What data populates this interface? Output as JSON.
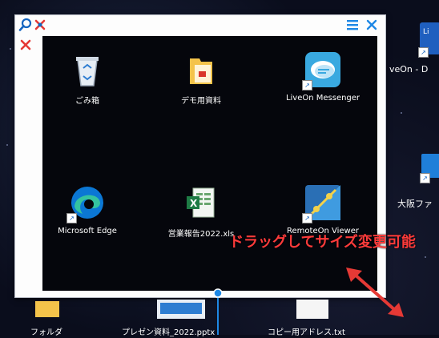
{
  "desktop": {
    "background_color": "#0a0d1c",
    "right_icons": [
      {
        "label": "veOn - D",
        "icon": "liveon-desktop-icon"
      },
      {
        "label": "大阪ファ",
        "icon": "folder-icon"
      }
    ],
    "bottom_icons": [
      {
        "label": "フォルダ",
        "icon": "folder-icon"
      },
      {
        "label": "プレゼン資料_2022.pptx",
        "icon": "powerpoint-file-icon"
      },
      {
        "label": "コピー用アドレス.txt",
        "icon": "text-file-icon"
      }
    ]
  },
  "viewer": {
    "toolbar": {
      "zoom_icon": "magnifier-icon",
      "pin_icon": "pin-icon",
      "menu_icon": "hamburger-menu-icon",
      "close_icon": "close-icon",
      "side_pin_icon": "pin-icon"
    },
    "icons": [
      {
        "label": "ごみ箱",
        "icon": "recycle-bin-icon"
      },
      {
        "label": "デモ用資料",
        "icon": "folder-icon"
      },
      {
        "label": "LiveOn Messenger",
        "icon": "liveon-messenger-icon"
      },
      {
        "label": "Microsoft Edge",
        "icon": "edge-browser-icon"
      },
      {
        "label": "営業報告2022.xls",
        "icon": "excel-file-icon"
      },
      {
        "label": "RemoteOn Viewer",
        "icon": "remoteon-viewer-icon"
      }
    ]
  },
  "annotation": {
    "caption": "ドラッグしてサイズ変更可能",
    "caption_color": "#ff3b3b",
    "arrow_color": "#e53935"
  },
  "accent_color": "#1e88e5"
}
